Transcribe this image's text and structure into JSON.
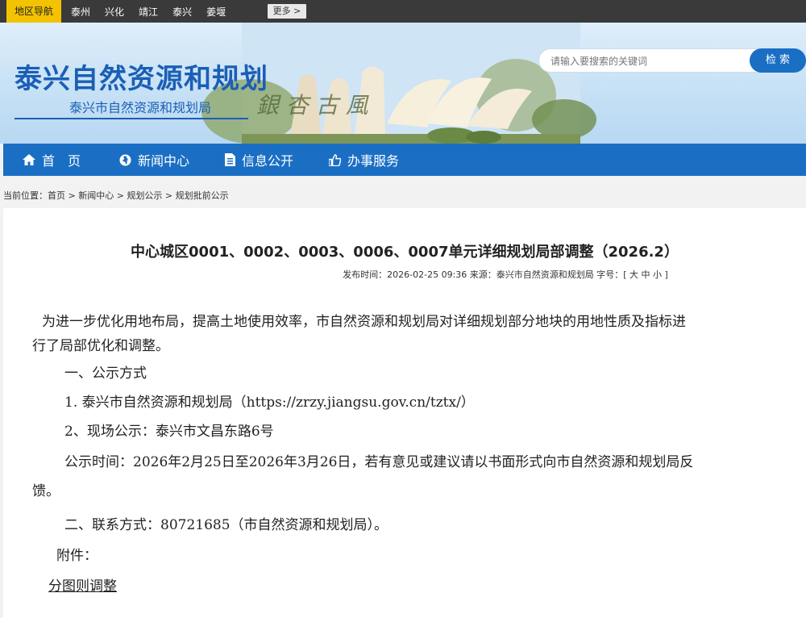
{
  "topbar": {
    "region_label": "地区导航",
    "regions": [
      "泰州",
      "兴化",
      "靖江",
      "泰兴",
      "姜堰"
    ],
    "more_label": "更多 >"
  },
  "header": {
    "site_title": "泰兴自然资源和规划",
    "site_subtitle": "泰兴市自然资源和规划局",
    "search_placeholder": "请输入要搜索的关键词",
    "search_button": "检 索"
  },
  "nav": {
    "items": [
      {
        "label": "首　页",
        "icon": "home-icon"
      },
      {
        "label": "新闻中心",
        "icon": "globe-icon"
      },
      {
        "label": "信息公开",
        "icon": "document-icon"
      },
      {
        "label": "办事服务",
        "icon": "thumbs-up-icon"
      }
    ]
  },
  "breadcrumb": {
    "text": "当前位置：首页 > 新闻中心 > 规划公示 > 规划批前公示"
  },
  "article": {
    "title": "中心城区0001、0002、0003、0006、0007单元详细规划局部调整（2026.2）",
    "meta": "发布时间：2026-02-25 09:36  来源：泰兴市自然资源和规划局  字号：[ 大 中 小 ]",
    "para1_line1": "为进一步优化用地布局，提高土地使用效率，市自然资源和规划局对详细规划部分地块的用地性质及指标进",
    "para1_line2": "行了局部优化和调整。",
    "section1": "一、公示方式",
    "method1": "1. 泰兴市自然资源和规划局（https://zrzy.jiangsu.gov.cn/tztx/）",
    "method2": "2、现场公示：泰兴市文昌东路6号",
    "period_line1": "公示时间：2026年2月25日至2026年3月26日，若有意见或建议请以书面形式向市自然资源和规划局反",
    "period_line2": "馈。",
    "contact": "二、联系方式：80721685（市自然资源和规划局）。",
    "attachment_label": "附件：",
    "attachment_link": "分图则调整"
  }
}
